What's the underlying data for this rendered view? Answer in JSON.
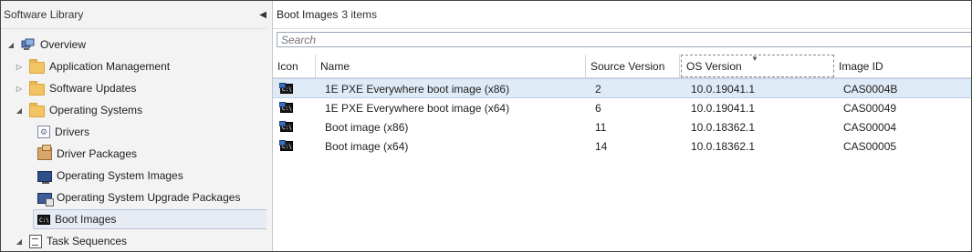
{
  "left_pane": {
    "title": "Software Library",
    "collapse_glyph": "◀",
    "tree": [
      {
        "label": "Overview",
        "icon": "overview-icon",
        "expander": "◢"
      },
      {
        "label": "Application Management",
        "icon": "folder-icon",
        "expander": "▷"
      },
      {
        "label": "Software Updates",
        "icon": "folder-icon",
        "expander": "▷"
      },
      {
        "label": "Operating Systems",
        "icon": "folder-icon",
        "expander": "◢"
      },
      {
        "label": "Drivers",
        "icon": "driver-icon"
      },
      {
        "label": "Driver Packages",
        "icon": "package-icon"
      },
      {
        "label": "Operating System Images",
        "icon": "os-image-icon"
      },
      {
        "label": "Operating System Upgrade Packages",
        "icon": "os-upgrade-package-icon"
      },
      {
        "label": "Boot Images",
        "icon": "boot-image-icon",
        "selected": true
      },
      {
        "label": "Task Sequences",
        "icon": "task-sequence-icon",
        "expander": "◢"
      }
    ]
  },
  "main": {
    "title": "Boot Images",
    "item_count": "3 items",
    "search_placeholder": "Search",
    "columns": [
      "Icon",
      "Name",
      "Source Version",
      "OS Version",
      "Image ID"
    ],
    "sorted_column": "OS Version",
    "rows": [
      {
        "name": "1E PXE Everywhere boot image (x86)",
        "source_version": "2",
        "os_version": "10.0.19041.1",
        "image_id": "CAS0004B",
        "selected": true
      },
      {
        "name": "1E PXE Everywhere boot image (x64)",
        "source_version": "6",
        "os_version": "10.0.19041.1",
        "image_id": "CAS00049"
      },
      {
        "name": "Boot image (x86)",
        "source_version": "11",
        "os_version": "10.0.18362.1",
        "image_id": "CAS00004"
      },
      {
        "name": "Boot image (x64)",
        "source_version": "14",
        "os_version": "10.0.18362.1",
        "image_id": "CAS00005"
      }
    ]
  },
  "colors": {
    "selection": "#dfeaf7",
    "pane_bg": "#f3f3f3"
  }
}
